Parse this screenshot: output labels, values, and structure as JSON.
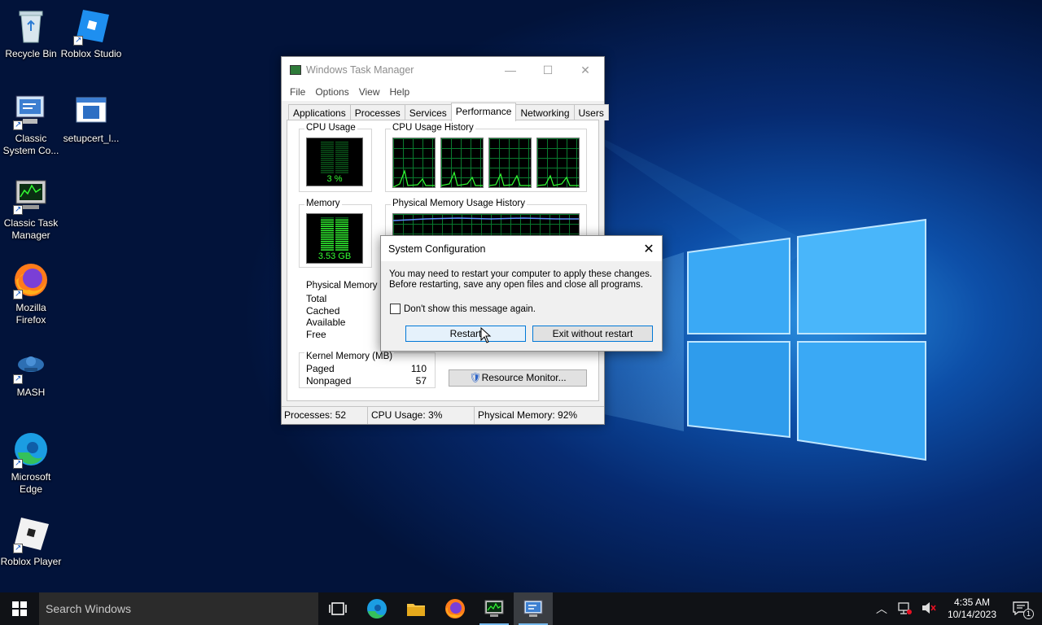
{
  "desktop": {
    "icons": [
      {
        "label": "Recycle Bin",
        "icon": "recycle-bin-icon"
      },
      {
        "label": "Roblox Studio",
        "icon": "roblox-studio-icon"
      },
      {
        "label": "Classic System Co...",
        "icon": "system-config-icon"
      },
      {
        "label": "setupcert_l...",
        "icon": "file-icon"
      },
      {
        "label": "Classic Task Manager",
        "icon": "task-manager-icon"
      },
      {
        "label": "Mozilla Firefox",
        "icon": "firefox-icon"
      },
      {
        "label": "MASH",
        "icon": "mash-icon"
      },
      {
        "label": "Microsoft Edge",
        "icon": "edge-icon"
      },
      {
        "label": "Roblox Player",
        "icon": "roblox-player-icon"
      }
    ]
  },
  "taskmgr": {
    "title": "Windows Task Manager",
    "menu": [
      "File",
      "Options",
      "View",
      "Help"
    ],
    "tabs": [
      "Applications",
      "Processes",
      "Services",
      "Performance",
      "Networking",
      "Users"
    ],
    "active_tab": "Performance",
    "cpu_usage_label": "CPU Usage",
    "cpu_usage_value": "3 %",
    "cpu_usage_fraction": 0.03,
    "cpu_history_label": "CPU Usage History",
    "memory_label": "Memory",
    "memory_value": "3.53 GB",
    "memory_fraction": 0.92,
    "mem_history_label": "Physical Memory Usage History",
    "physical_memory_label": "Physical Memory (M",
    "physical_rows": [
      "Total",
      "Cached",
      "Available",
      "Free"
    ],
    "kernel_label": "Kernel Memory (MB)",
    "kernel_rows": [
      {
        "label": "Paged",
        "value": "110"
      },
      {
        "label": "Nonpaged",
        "value": "57"
      }
    ],
    "resource_monitor_label": "Resource Monitor...",
    "status": {
      "processes": "Processes: 52",
      "cpu": "CPU Usage: 3%",
      "memory": "Physical Memory: 92%"
    }
  },
  "syscfg": {
    "title": "System Configuration",
    "message_line1": "You may need to restart your computer to apply these changes.",
    "message_line2": "Before restarting, save any open files and close all programs.",
    "checkbox_label": "Don't show this message again.",
    "checkbox_checked": false,
    "restart_label": "Restart",
    "exit_label": "Exit without restart"
  },
  "taskbar": {
    "search_placeholder": "Search Windows",
    "time": "4:35 AM",
    "date": "10/14/2023",
    "notification_count": "1"
  }
}
